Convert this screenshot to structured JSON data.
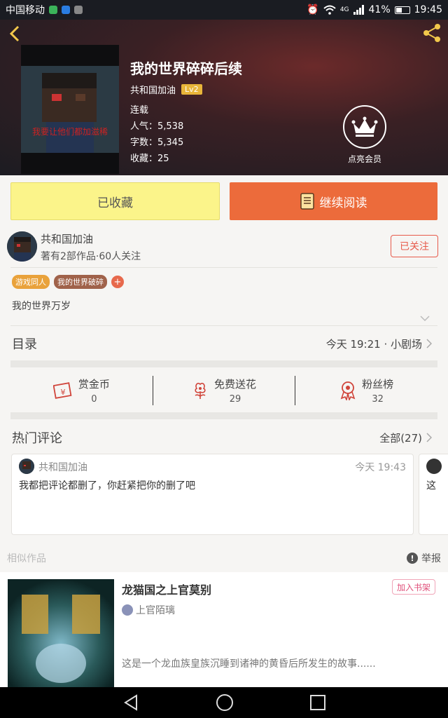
{
  "status_bar": {
    "carrier": "中国移动",
    "network": "4G",
    "battery": "41%",
    "time": "19:45"
  },
  "book": {
    "title": "我的世界碎碎后续",
    "author": "共和国加油",
    "level": "Lv2",
    "status": "连载",
    "popularity": "人气：5,538",
    "words": "字数：5,345",
    "favorites": "收藏：25",
    "cover_caption": "我要让他们都加滋稀"
  },
  "vip": {
    "label": "点亮会员"
  },
  "actions": {
    "collected_label": "已收藏",
    "read_label": "继续阅读"
  },
  "author_info": {
    "name": "共和国加油",
    "sub": "著有2部作品·60人关注",
    "follow_label": "已关注"
  },
  "tags": [
    {
      "label": "游戏同人",
      "color": "#e9a23b"
    },
    {
      "label": "我的世界破碎",
      "color": "#a0624a"
    }
  ],
  "description": "我的世界万岁",
  "toc": {
    "title": "目录",
    "latest": "今天 19:21 · 小剧场"
  },
  "stats": [
    {
      "label": "赏金币",
      "value": "0",
      "icon": "coin-envelope-icon"
    },
    {
      "label": "免费送花",
      "value": "29",
      "icon": "flower-icon"
    },
    {
      "label": "粉丝榜",
      "value": "32",
      "icon": "medal-icon"
    }
  ],
  "hot_comments": {
    "title": "热门评论",
    "all_label": "全部(27)",
    "items": [
      {
        "user": "共和国加油",
        "time": "今天 19:43",
        "text": "我都把评论都删了，你赶紧把你的删了吧"
      }
    ],
    "partial_text": "这"
  },
  "similar": {
    "title": "相似作品",
    "report_label": "举报",
    "items": [
      {
        "title": "龙猫国之上官莫别",
        "author": "上官陌璃",
        "add_label": "加入书架",
        "desc": "这是一个龙血族皇族沉睡到诸神的黄昏后所发生的故事......"
      }
    ]
  },
  "colors": {
    "accent_orange": "#ec6b3b",
    "collected_yellow": "#fbf48a",
    "follow_red": "#e75a4b"
  }
}
